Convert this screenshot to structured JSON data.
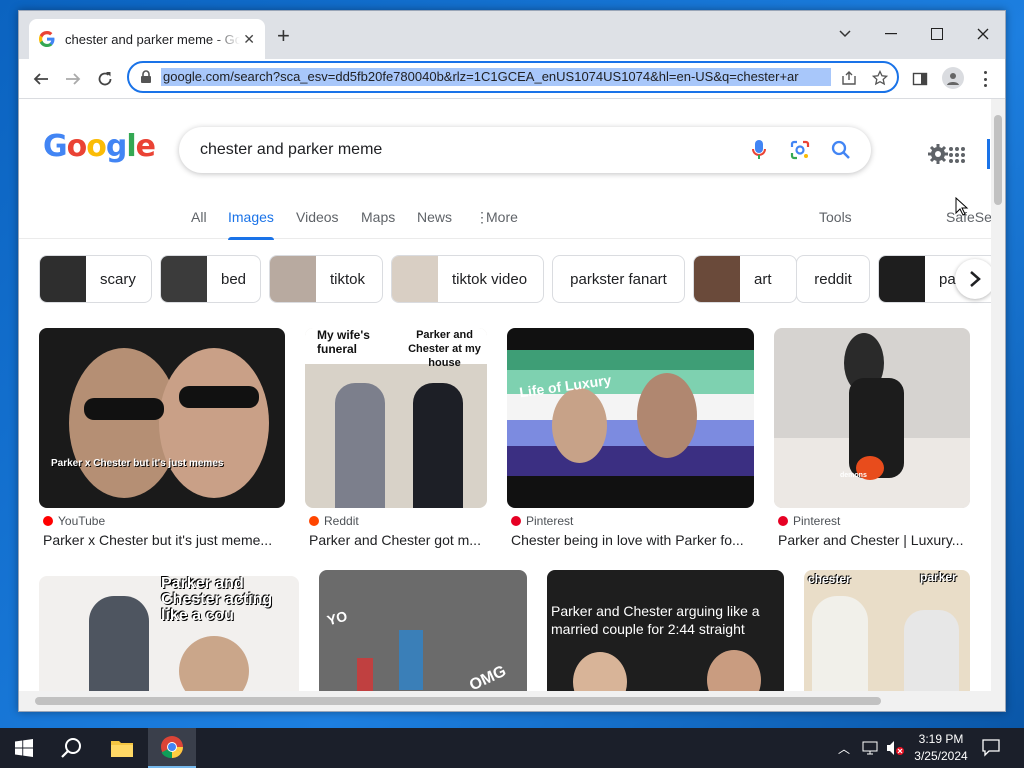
{
  "browser": {
    "tab_title": "chester and parker meme - Goog",
    "url": "google.com/search?sca_esv=dd5fb20fe780040b&rlz=1C1GCEA_enUS1074US1074&hl=en-US&q=chester+ar"
  },
  "google": {
    "logo": "Google",
    "query": "chester and parker meme",
    "tabs": [
      "All",
      "Images",
      "Videos",
      "Maps",
      "News",
      "More"
    ],
    "active_tab": "Images",
    "tools": "Tools",
    "safesearch": "SafeSe"
  },
  "chips": [
    {
      "label": "scary",
      "thumb": true
    },
    {
      "label": "bed",
      "thumb": true
    },
    {
      "label": "tiktok",
      "thumb": true
    },
    {
      "label": "tiktok video",
      "thumb": true
    },
    {
      "label": "parkster fanart",
      "thumb": false
    },
    {
      "label": "art",
      "thumb": true
    },
    {
      "label": "reddit",
      "thumb": false
    },
    {
      "label": "pa",
      "thumb": true
    }
  ],
  "results_row1": [
    {
      "source": "YouTube",
      "source_color": "#ff0000",
      "title": "Parker x Chester but it's just meme...",
      "caption": "Parker x Chester but it's just memes"
    },
    {
      "source": "Reddit",
      "source_color": "#ff4500",
      "title": "Parker and Chester got m...",
      "caption_left": "My wife's funeral",
      "caption_right": "Parker and Chester at my house"
    },
    {
      "source": "Pinterest",
      "source_color": "#e60023",
      "title": "Chester being in love with Parker fo...",
      "caption": "Life of Luxury"
    },
    {
      "source": "Pinterest",
      "source_color": "#e60023",
      "title": "Parker and Chester | Luxury...",
      "caption": "demons"
    }
  ],
  "results_row2": [
    {
      "caption": "Parker and Chester acting like a cou"
    },
    {
      "caption_a": "YO",
      "caption_b": "OMG"
    },
    {
      "caption": "Parker and Chester arguing like a married couple for 2:44 straight"
    },
    {
      "caption_left": "chester",
      "caption_right": "parker"
    }
  ],
  "taskbar": {
    "time": "3:19 PM",
    "date": "3/25/2024"
  },
  "colors": {
    "accent": "#1a73e8",
    "taskbar": "#1b1f2a",
    "desktop": "#0b63c0"
  }
}
